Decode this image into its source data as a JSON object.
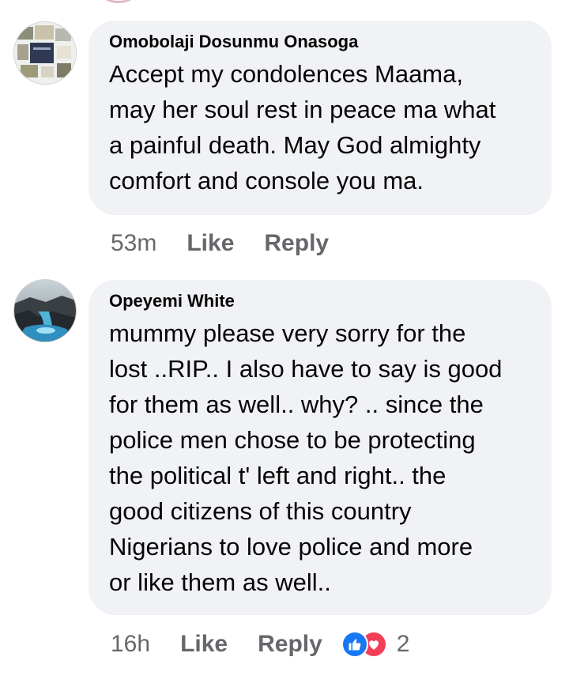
{
  "comments": [
    {
      "author": "Omobolaji Dosunmu Onasoga",
      "text": "Accept my condolences Maama,\nmay her soul rest in peace ma what\na painful death. May God almighty\ncomfort and console you ma.",
      "time": "53m",
      "like_label": "Like",
      "reply_label": "Reply"
    },
    {
      "author": "Opeyemi White",
      "text": "mummy please very sorry for the\nlost ..RIP.. I also have to say is good\nfor them as well.. why? ..  since the\npolice men chose to be protecting\nthe political t'       left and right.. the\ngood citizens of this country\nNigerians to love police and more\nor like them as well..",
      "time": "16h",
      "like_label": "Like",
      "reply_label": "Reply",
      "reaction_icons": [
        "like-icon",
        "heart-icon"
      ],
      "reaction_count": "2"
    }
  ],
  "colors": {
    "bubble": "#f0f2f5",
    "meta_text": "#65676b",
    "like_blue": "#1877f2",
    "heart_red": "#f33e58"
  }
}
